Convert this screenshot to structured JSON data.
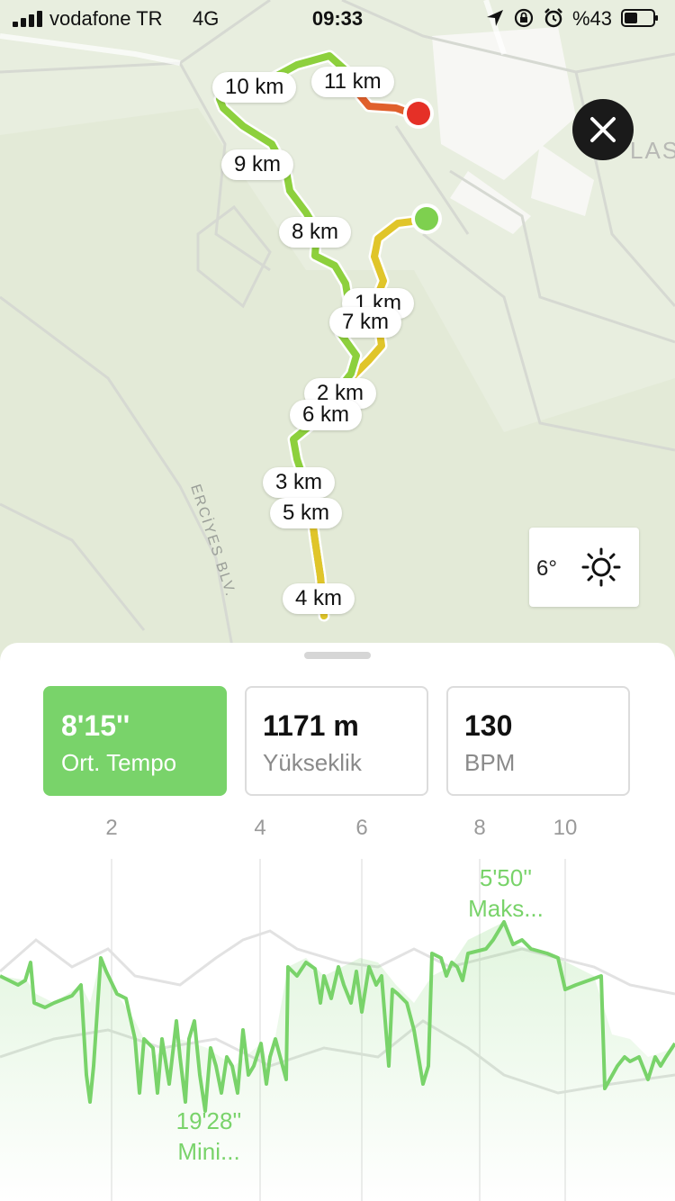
{
  "status": {
    "carrier": "vodafone TR",
    "network": "4G",
    "time": "09:33",
    "battery": "%43"
  },
  "map": {
    "road_label": "ERCİYES BLV.",
    "area_label": "LAS",
    "km_labels": [
      "10 km",
      "11 km",
      "9 km",
      "8 km",
      "1 km",
      "7 km",
      "2 km",
      "6 km",
      "3 km",
      "5 km",
      "4 km"
    ],
    "start_color": "#7ed04f",
    "end_color": "#e53027",
    "route_color": "#8dd03d"
  },
  "weather": {
    "temp": "6°",
    "icon": "sun-icon"
  },
  "stats": [
    {
      "value": "8'15''",
      "label": "Ort. Tempo",
      "active": true
    },
    {
      "value": "1171 m",
      "label": "Yükseklik",
      "active": false
    },
    {
      "value": "130",
      "label": "BPM",
      "active": false
    }
  ],
  "chart_data": {
    "type": "area",
    "x_ticks": [
      "2",
      "4",
      "6",
      "8",
      "10"
    ],
    "series_color": "#79d36a",
    "max_label": {
      "value": "5'50''",
      "label": "Maks..."
    },
    "min_label": {
      "value": "19'28''",
      "label": "Mini..."
    }
  },
  "colors": {
    "accent": "#79d36a",
    "map_bg": "#e8eedf"
  }
}
